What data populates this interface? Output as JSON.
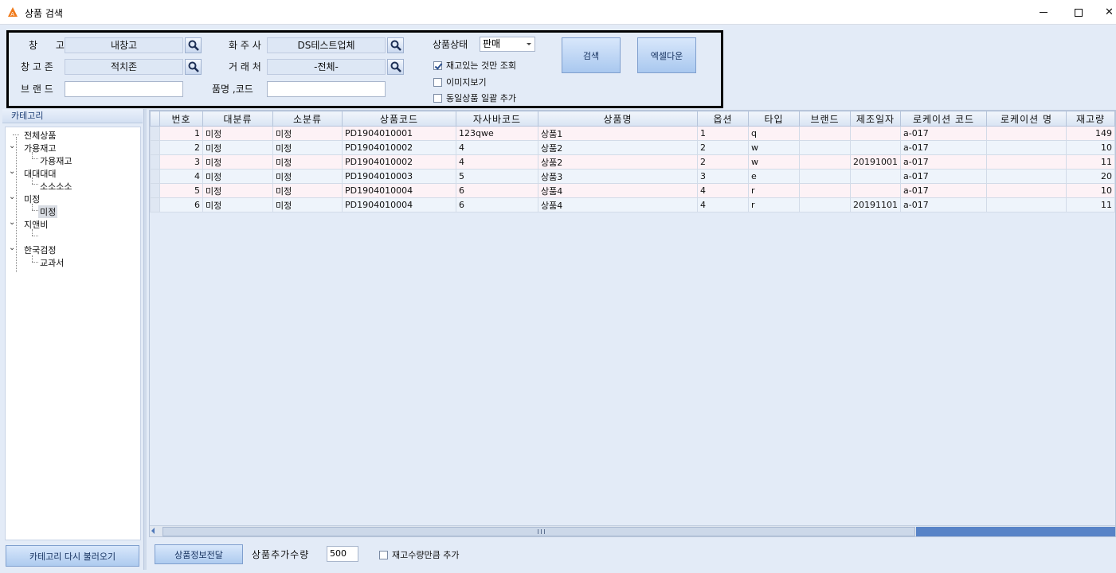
{
  "window": {
    "title": "상품 검색",
    "close_glyph": "✕"
  },
  "search": {
    "warehouse_label": "창      고",
    "warehouse_value": "내창고",
    "zone_label": "창 고 존",
    "zone_value": "적치존",
    "brand_label": "브 랜 드",
    "brand_value": "",
    "shipper_label": "화 주 사",
    "shipper_value": "DS테스트업체",
    "vendor_label": "거 래 처",
    "vendor_value": "-전체-",
    "product_label": "품명 ,코드",
    "product_value": "",
    "status_label": "상품상태",
    "status_value": "판매",
    "check_instock": "재고있는 것만 조회",
    "check_image": "이미지보기",
    "check_bulk": "동일상품 일괄 추가",
    "search_button": "검색",
    "excel_button": "엑셀다운"
  },
  "category": {
    "header": "카테고리",
    "items": [
      "전체상품",
      "가용재고",
      "가용재고",
      "대대대대",
      "소소소소",
      "미정",
      "미정",
      "지앤비",
      "한국검정",
      "교과서"
    ],
    "reload_button": "카테고리 다시 불러오기"
  },
  "grid": {
    "columns": [
      "번호",
      "대분류",
      "소분류",
      "상품코드",
      "자사바코드",
      "상품명",
      "옵션",
      "타입",
      "브랜드",
      "제조일자",
      "로케이션 코드",
      "로케이션 명",
      "재고량"
    ],
    "rows": [
      [
        "1",
        "미정",
        "미정",
        "PD1904010001",
        "123qwe",
        "상품1",
        "1",
        "q",
        "",
        "",
        "a-017",
        "",
        "149"
      ],
      [
        "2",
        "미정",
        "미정",
        "PD1904010002",
        "4",
        "상품2",
        "2",
        "w",
        "",
        "",
        "a-017",
        "",
        "10"
      ],
      [
        "3",
        "미정",
        "미정",
        "PD1904010002",
        "4",
        "상품2",
        "2",
        "w",
        "",
        "20191001",
        "a-017",
        "",
        "11"
      ],
      [
        "4",
        "미정",
        "미정",
        "PD1904010003",
        "5",
        "상품3",
        "3",
        "e",
        "",
        "",
        "a-017",
        "",
        "20"
      ],
      [
        "5",
        "미정",
        "미정",
        "PD1904010004",
        "6",
        "상품4",
        "4",
        "r",
        "",
        "",
        "a-017",
        "",
        "10"
      ],
      [
        "6",
        "미정",
        "미정",
        "PD1904010004",
        "6",
        "상품4",
        "4",
        "r",
        "",
        "20191101",
        "a-017",
        "",
        "11"
      ]
    ]
  },
  "bottom": {
    "transfer_button": "상품정보전달",
    "qty_label": "상품추가수량",
    "qty_value": "500",
    "check_stockqty": "재고수량만큼 추가"
  }
}
